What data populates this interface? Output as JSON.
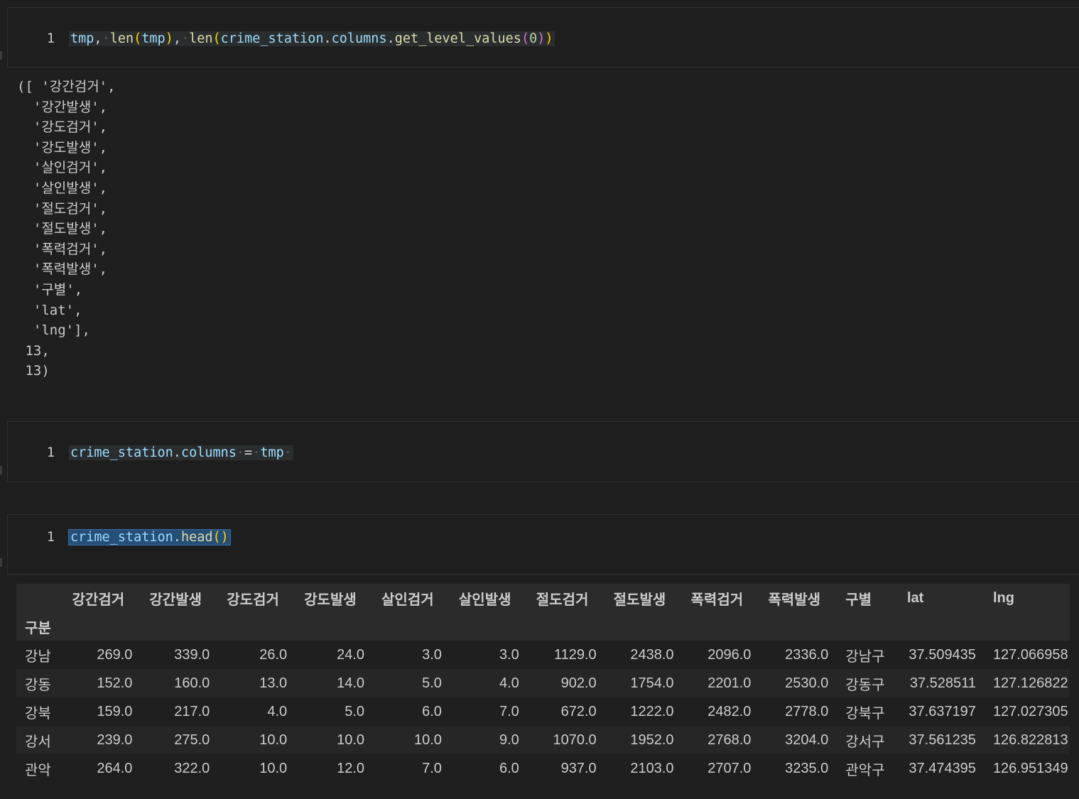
{
  "cell1": {
    "line_number": "1",
    "tokens": [
      {
        "t": "tmp",
        "c": "tok-var"
      },
      {
        "t": ",",
        "c": "tok-op"
      },
      {
        "t": "·",
        "c": "tok-ws"
      },
      {
        "t": "len",
        "c": "tok-fn"
      },
      {
        "t": "(",
        "c": "tok-par1"
      },
      {
        "t": "tmp",
        "c": "tok-var"
      },
      {
        "t": ")",
        "c": "tok-par1"
      },
      {
        "t": ",",
        "c": "tok-op"
      },
      {
        "t": "·",
        "c": "tok-ws"
      },
      {
        "t": "len",
        "c": "tok-fn"
      },
      {
        "t": "(",
        "c": "tok-par1"
      },
      {
        "t": "crime_station",
        "c": "tok-var"
      },
      {
        "t": ".",
        "c": "tok-op"
      },
      {
        "t": "columns",
        "c": "tok-var"
      },
      {
        "t": ".",
        "c": "tok-op"
      },
      {
        "t": "get_level_values",
        "c": "tok-fn"
      },
      {
        "t": "(",
        "c": "tok-par2"
      },
      {
        "t": "0",
        "c": "tok-num"
      },
      {
        "t": ")",
        "c": "tok-par2"
      },
      {
        "t": ")",
        "c": "tok-par1"
      }
    ]
  },
  "output1": "([ '강간검거',\n  '강간발생',\n  '강도검거',\n  '강도발생',\n  '살인검거',\n  '살인발생',\n  '절도검거',\n  '절도발생',\n  '폭력검거',\n  '폭력발생',\n  '구별',\n  'lat',\n  'lng'],\n 13,\n 13)",
  "cell2": {
    "line_number": "1",
    "tokens": [
      {
        "t": "crime_station",
        "c": "tok-var"
      },
      {
        "t": ".",
        "c": "tok-op"
      },
      {
        "t": "columns",
        "c": "tok-var"
      },
      {
        "t": "·",
        "c": "tok-ws"
      },
      {
        "t": "=",
        "c": "tok-op"
      },
      {
        "t": "·",
        "c": "tok-ws"
      },
      {
        "t": "tmp",
        "c": "tok-var"
      },
      {
        "t": "·",
        "c": "tok-ws"
      }
    ]
  },
  "cell3": {
    "line_number": "1",
    "tokens": [
      {
        "t": "crime_station",
        "c": "tok-var"
      },
      {
        "t": ".",
        "c": "tok-op"
      },
      {
        "t": "head",
        "c": "tok-fn"
      },
      {
        "t": "(",
        "c": "tok-par1"
      },
      {
        "t": ")",
        "c": "tok-par1"
      }
    ]
  },
  "dataframe": {
    "columns": [
      "강간검거",
      "강간발생",
      "강도검거",
      "강도발생",
      "살인검거",
      "살인발생",
      "절도검거",
      "절도발생",
      "폭력검거",
      "폭력발생",
      "구별",
      "lat",
      "lng"
    ],
    "index_name": "구분",
    "rows": [
      {
        "index": "강남",
        "values": [
          "269.0",
          "339.0",
          "26.0",
          "24.0",
          "3.0",
          "3.0",
          "1129.0",
          "2438.0",
          "2096.0",
          "2336.0",
          "강남구",
          "37.509435",
          "127.066958"
        ]
      },
      {
        "index": "강동",
        "values": [
          "152.0",
          "160.0",
          "13.0",
          "14.0",
          "5.0",
          "4.0",
          "902.0",
          "1754.0",
          "2201.0",
          "2530.0",
          "강동구",
          "37.528511",
          "127.126822"
        ]
      },
      {
        "index": "강북",
        "values": [
          "159.0",
          "217.0",
          "4.0",
          "5.0",
          "6.0",
          "7.0",
          "672.0",
          "1222.0",
          "2482.0",
          "2778.0",
          "강북구",
          "37.637197",
          "127.027305"
        ]
      },
      {
        "index": "강서",
        "values": [
          "239.0",
          "275.0",
          "10.0",
          "10.0",
          "10.0",
          "9.0",
          "1070.0",
          "1952.0",
          "2768.0",
          "3204.0",
          "강서구",
          "37.561235",
          "126.822813"
        ]
      },
      {
        "index": "관악",
        "values": [
          "264.0",
          "322.0",
          "10.0",
          "12.0",
          "7.0",
          "6.0",
          "937.0",
          "2103.0",
          "2707.0",
          "3235.0",
          "관악구",
          "37.474395",
          "126.951349"
        ]
      }
    ]
  }
}
